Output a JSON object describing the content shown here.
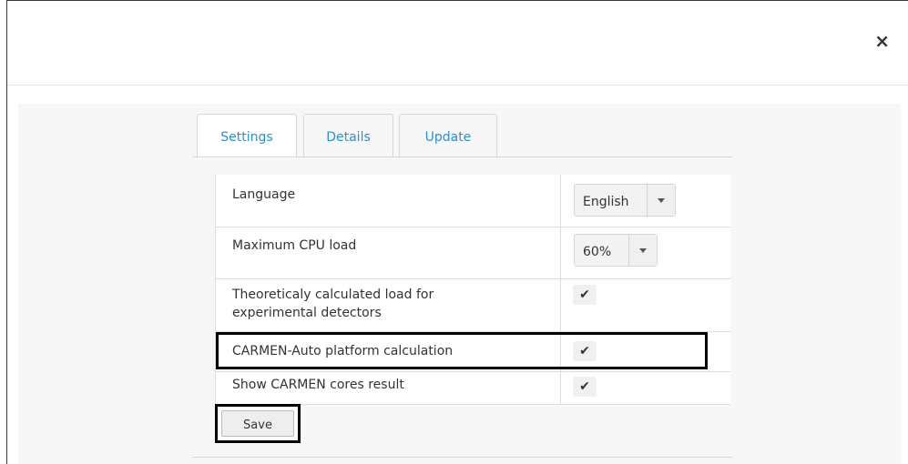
{
  "dialog": {
    "close_icon": "×"
  },
  "tabs": [
    {
      "label": "Settings",
      "active": true
    },
    {
      "label": "Details",
      "active": false
    },
    {
      "label": "Update",
      "active": false
    }
  ],
  "settings": {
    "language": {
      "label": "Language",
      "value": "English"
    },
    "cpu": {
      "label": "Maximum CPU load",
      "value": "60%"
    },
    "theoretical": {
      "label_line1": "Theoreticaly calculated load for",
      "label_line2": "experimental detectors",
      "checked": true
    },
    "carmen_auto": {
      "label": "CARMEN-Auto platform calculation",
      "checked": true
    },
    "carmen_cores": {
      "label": "Show CARMEN cores result",
      "checked": true
    }
  },
  "check_glyph": "✔",
  "save_label": "Save",
  "colors": {
    "tab_text": "#2f8fc9",
    "highlight": "#000000"
  }
}
